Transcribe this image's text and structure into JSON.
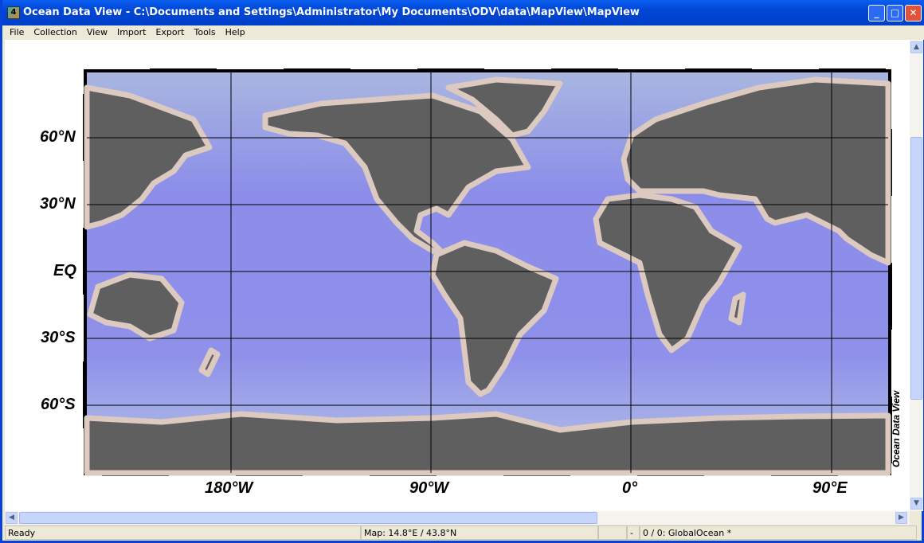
{
  "window": {
    "title": "Ocean Data View - C:\\Documents and Settings\\Administrator\\My Documents\\ODV\\data\\MapView\\MapView",
    "app_icon_text": "4"
  },
  "menu": [
    "File",
    "Collection",
    "View",
    "Import",
    "Export",
    "Tools",
    "Help"
  ],
  "map": {
    "lat_labels": [
      "60°N",
      "30°N",
      "EQ",
      "30°S",
      "60°S"
    ],
    "lon_labels": [
      "180°W",
      "90°W",
      "0°",
      "90°E"
    ],
    "watermark": "Ocean Data View",
    "colors": {
      "land": "#5f5f5f",
      "ocean": "#8c8ee8",
      "shelf": "#dcc9c0"
    }
  },
  "status": {
    "message": "Ready",
    "map_position": "Map:  14.8°E / 43.8°N",
    "dash": "-",
    "collection": "0 / 0: GlobalOcean *"
  }
}
